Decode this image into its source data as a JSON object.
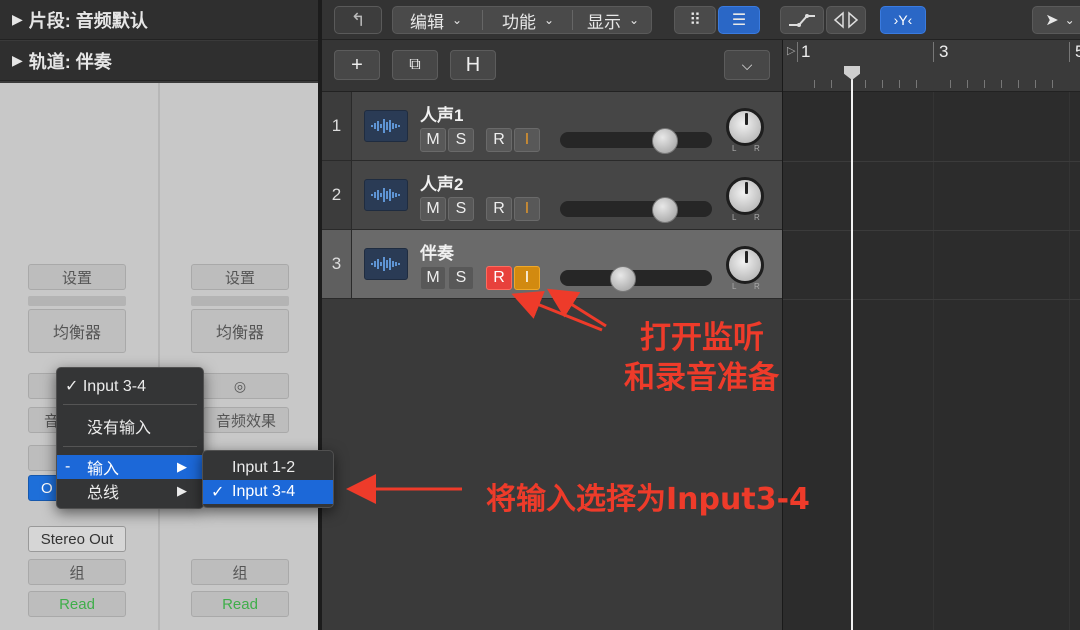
{
  "inspector": {
    "region_label": "片段: 音频默认",
    "track_label": "轨道:  伴奏",
    "strip_left": {
      "settings": "设置",
      "eq": "均衡器",
      "audio_fx_partial": "音",
      "output_partial": "O",
      "stereo_out": "Stereo Out",
      "group": "组",
      "read": "Read"
    },
    "strip_right": {
      "settings": "设置",
      "eq": "均衡器",
      "audio_fx": "音频效果",
      "group": "组",
      "read": "Read"
    }
  },
  "toolbar": {
    "edit": "编辑",
    "function": "功能",
    "view": "显示"
  },
  "track_toolbar": {
    "add": "+",
    "h": "H"
  },
  "tracks": [
    {
      "num": "1",
      "name": "人声1",
      "m": "M",
      "s": "S",
      "r": "R",
      "i": "I",
      "volume": 0.73,
      "selected": false
    },
    {
      "num": "2",
      "name": "人声2",
      "m": "M",
      "s": "S",
      "r": "R",
      "i": "I",
      "volume": 0.73,
      "selected": false
    },
    {
      "num": "3",
      "name": "伴奏",
      "m": "M",
      "s": "S",
      "r": "R",
      "i": "I",
      "volume": 0.4,
      "selected": true
    }
  ],
  "knob_labels": {
    "l": "L",
    "r": "R"
  },
  "ruler": {
    "bar1": "1",
    "bar3": "3",
    "bar5": "5"
  },
  "input_menu": {
    "current": "✓ Input 3-4",
    "no_input": "没有输入",
    "input": "输入",
    "input_prefix": "-",
    "bus": "总线",
    "arrow": "▶"
  },
  "input_submenu": {
    "item1": "Input 1-2",
    "item2": "Input 3-4",
    "check": "✓"
  },
  "annotations": {
    "monitor_line1": "打开监听",
    "monitor_line2": "和录音准备",
    "input_select": "将输入选择为Input3-4"
  },
  "colors": {
    "accent_blue": "#1c68d8",
    "record_red": "#e8413c",
    "input_orange": "#d28a10",
    "annotation_red": "#ee3b2a",
    "read_green": "#3fae4a"
  }
}
